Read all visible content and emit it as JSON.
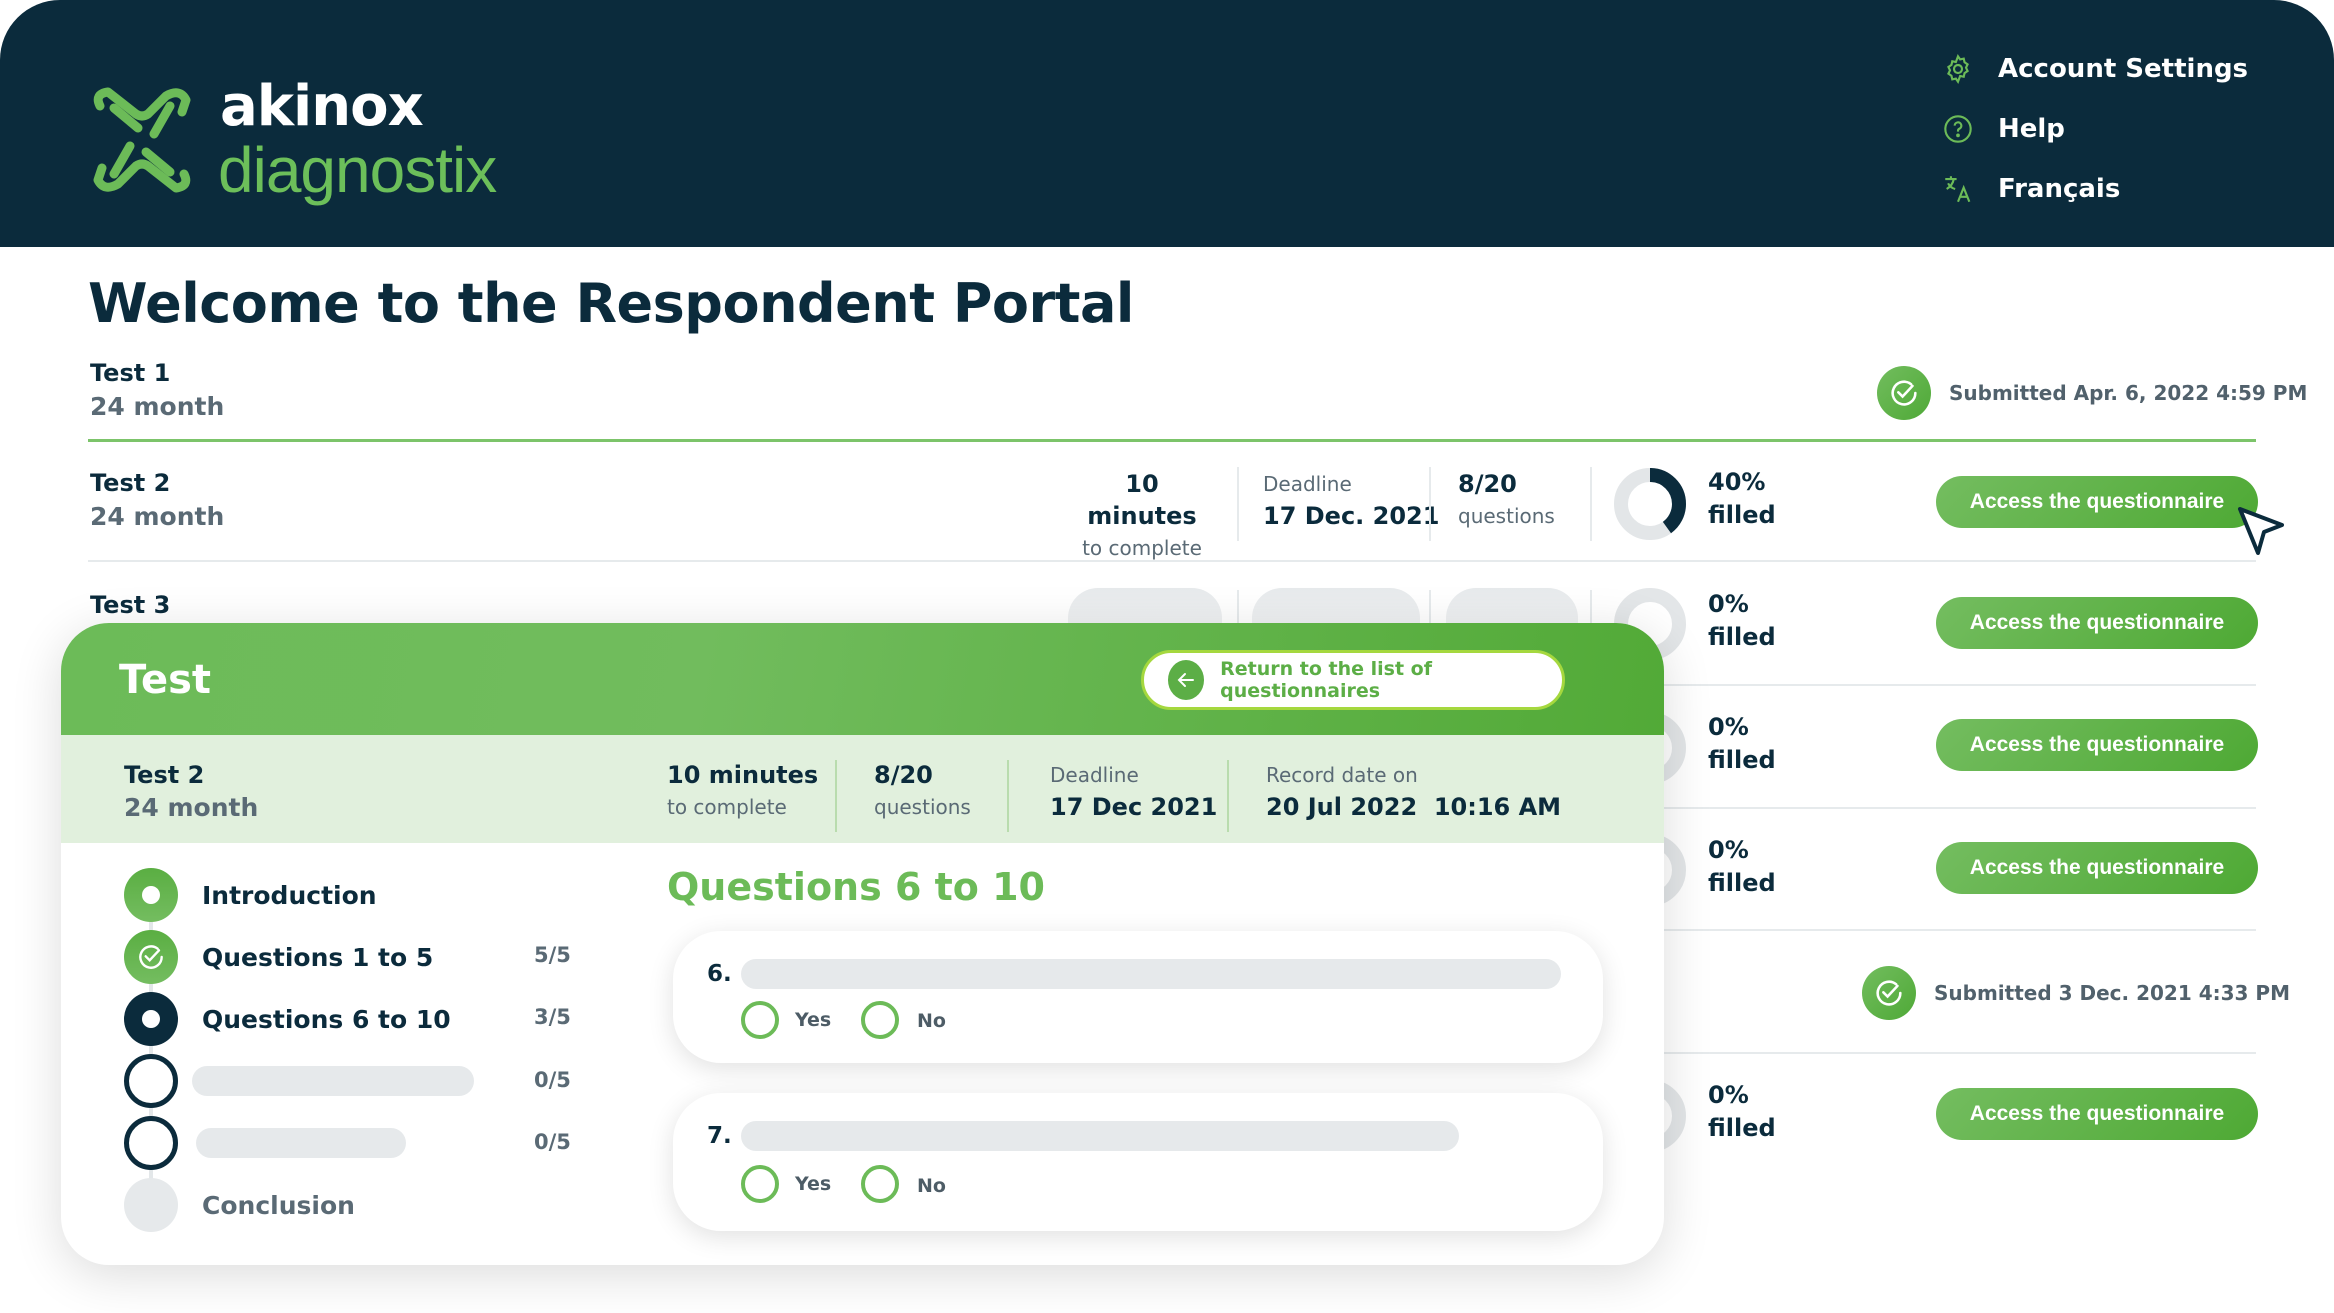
{
  "header": {
    "logo_word1": "akinox",
    "logo_word2": "diagnostix",
    "nav": [
      {
        "icon": "gear-icon",
        "label": "Account Settings"
      },
      {
        "icon": "help-circle-icon",
        "label": "Help"
      },
      {
        "icon": "translate-icon",
        "label": "Français"
      }
    ]
  },
  "page": {
    "title": "Welcome to the Respondent Portal"
  },
  "questionnaires": [
    {
      "name": "Test 1",
      "sub": "24 month",
      "status": "submitted",
      "submitted_text": "Submitted Apr. 6, 2022 4:59 PM"
    },
    {
      "name": "Test 2",
      "sub": "24 month",
      "duration": "10 minutes",
      "duration_sub": "to complete",
      "deadline_label": "Deadline",
      "deadline": "17 Dec. 2021",
      "questions": "8/20",
      "questions_sub": "questions",
      "progress": 0.4,
      "percent": "40%",
      "percent_sub": "filled",
      "action": "Access the questionnaire"
    },
    {
      "name": "Test 3",
      "progress": 0.0,
      "percent": "0%",
      "percent_sub": "filled",
      "action": "Access the questionnaire"
    },
    {
      "progress": 0.0,
      "percent": "0%",
      "percent_sub": "filled",
      "action": "Access the questionnaire"
    },
    {
      "progress": 0.0,
      "percent": "0%",
      "percent_sub": "filled",
      "action": "Access the questionnaire"
    },
    {
      "status": "submitted",
      "submitted_text": "Submitted 3 Dec. 2021 4:33 PM"
    },
    {
      "progress": 0.0,
      "percent": "0%",
      "percent_sub": "filled",
      "action": "Access the questionnaire"
    }
  ],
  "overlay": {
    "title": "Test",
    "return_label": "Return to the list of questionnaires",
    "info": {
      "name": "Test 2",
      "sub": "24 month",
      "duration": "10 minutes",
      "duration_sub": "to complete",
      "questions": "8/20",
      "questions_sub": "questions",
      "deadline_label": "Deadline",
      "deadline": "17 Dec 2021",
      "record_label": "Record date on",
      "record_date": "20 Jul 2022  10:16 AM"
    },
    "steps": [
      {
        "label": "Introduction",
        "state": "visited",
        "count": ""
      },
      {
        "label": "Questions 1 to 5",
        "state": "complete",
        "count": "5/5"
      },
      {
        "label": "Questions 6 to 10",
        "state": "current",
        "count": "3/5"
      },
      {
        "label": "",
        "state": "pending",
        "count": "0/5"
      },
      {
        "label": "",
        "state": "pending",
        "count": "0/5"
      },
      {
        "label": "Conclusion",
        "state": "disabled",
        "count": ""
      }
    ],
    "section_title": "Questions 6 to 10",
    "questions": [
      {
        "number": "6.",
        "options": [
          "Yes",
          "No"
        ]
      },
      {
        "number": "7.",
        "options": [
          "Yes",
          "No"
        ]
      }
    ]
  },
  "colors": {
    "brand_dark": "#0b2b3c",
    "brand_green": "#6cbb58",
    "band_green": "#e1f0dd"
  }
}
